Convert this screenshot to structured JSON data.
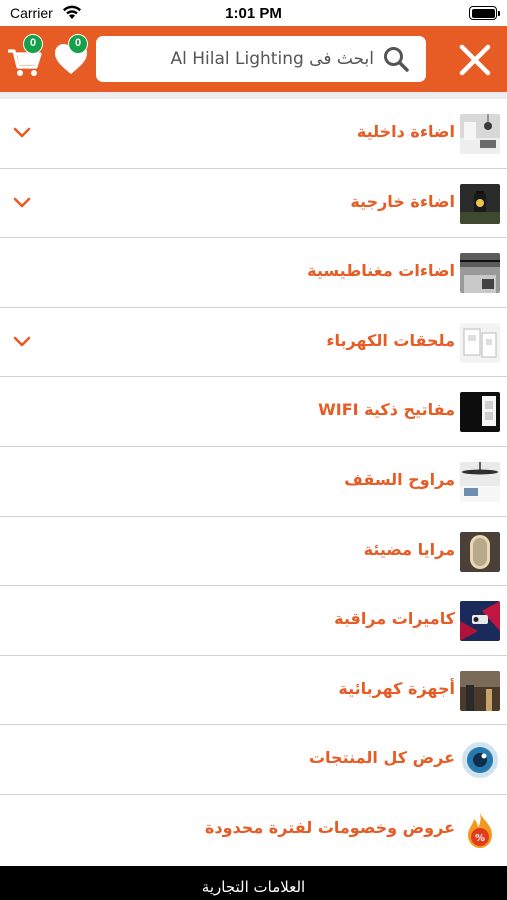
{
  "status_bar": {
    "carrier": "Carrier",
    "time": "1:01 PM"
  },
  "header": {
    "cart_count": "0",
    "wishlist_count": "0",
    "search_placeholder": "ابحث فى Al Hilal Lighting",
    "accent_color": "#e65c24",
    "badge_color": "#15a04a"
  },
  "menu": {
    "items": [
      {
        "label": "اضاءة داخلية",
        "expandable": true,
        "icon": "indoor-lighting-thumb"
      },
      {
        "label": "اضاءة خارجية",
        "expandable": true,
        "icon": "outdoor-lighting-thumb"
      },
      {
        "label": "اضاءات مغناطيسية",
        "expandable": false,
        "icon": "magnetic-lighting-thumb"
      },
      {
        "label": "ملحقات الكهرباء",
        "expandable": true,
        "icon": "electrical-accessories-thumb"
      },
      {
        "label": "مفاتيح ذكية WIFI",
        "expandable": false,
        "icon": "smart-switch-thumb"
      },
      {
        "label": "مراوح السقف",
        "expandable": false,
        "icon": "ceiling-fan-thumb"
      },
      {
        "label": "مرايا مضيئة",
        "expandable": false,
        "icon": "lit-mirror-thumb"
      },
      {
        "label": "كاميرات مراقبة",
        "expandable": false,
        "icon": "security-camera-thumb"
      },
      {
        "label": "أجهزة كهربائية",
        "expandable": false,
        "icon": "electrical-appliances-thumb"
      },
      {
        "label": "عرض كل المنتجات",
        "expandable": false,
        "icon": "eye-icon"
      },
      {
        "label": "عروض وخصومات لفترة محدودة",
        "expandable": false,
        "icon": "fire-discount-icon"
      }
    ]
  },
  "footer": {
    "label": "العلامات التجارية"
  }
}
